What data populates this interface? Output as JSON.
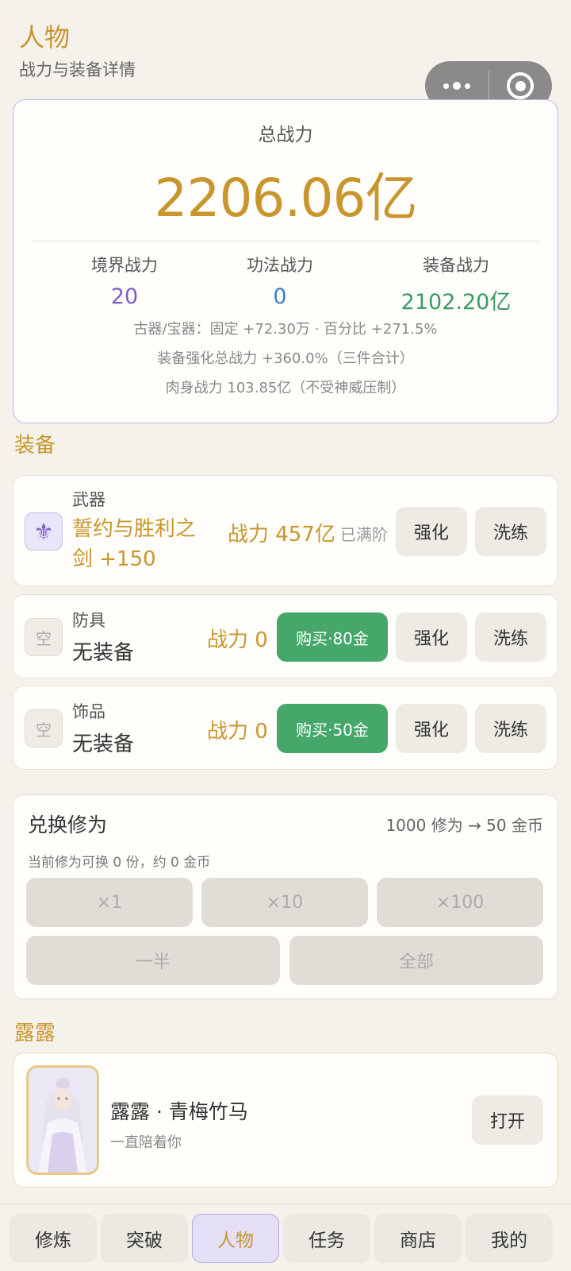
{
  "header": {
    "title": "人物",
    "subtitle": "战力与装备详情"
  },
  "capsule": {
    "more_icon": "more-dots-icon",
    "close_icon": "target-circle-icon"
  },
  "power": {
    "label": "总战力",
    "total": "2206.06亿",
    "stats": {
      "realm": {
        "label": "境界战力",
        "value": "20",
        "color": "#7b5ec6"
      },
      "skill": {
        "label": "功法战力",
        "value": "0",
        "color": "#3f7fc8"
      },
      "equip": {
        "label": "装备战力",
        "value": "2102.20亿",
        "color": "#3a9a64"
      }
    },
    "notes": [
      "古器/宝器：固定 +72.30万 · 百分比 +271.5%",
      "装备强化总战力 +360.0%（三件合计）",
      "肉身战力 103.85亿（不受神威压制）"
    ]
  },
  "equipment": {
    "section_title": "装备",
    "items": [
      {
        "icon": "fleur-de-lis-icon",
        "icon_glyph": "⚜",
        "type": "武器",
        "name_line1": "誓约与胜利之",
        "name_line2": "剑 +150",
        "power": "战力 457亿",
        "status": "已满阶",
        "enhance": "强化",
        "refine": "洗练"
      },
      {
        "icon_text": "空",
        "type": "防具",
        "name": "无装备",
        "power": "战力 0",
        "buy": "购买·80金",
        "enhance": "强化",
        "refine": "洗练"
      },
      {
        "icon_text": "空",
        "type": "饰品",
        "name": "无装备",
        "power": "战力 0",
        "buy": "购买·50金",
        "enhance": "强化",
        "refine": "洗练"
      }
    ]
  },
  "exchange": {
    "title": "兑换修为",
    "rate": "1000 修为 → 50 金币",
    "info": "当前修为可换 0 份，约 0 金币",
    "buttons": [
      "×1",
      "×10",
      "×100",
      "一半",
      "全部"
    ]
  },
  "companion": {
    "section_title": "露露",
    "name": "露露 · 青梅竹马",
    "desc": "一直陪着你",
    "open": "打开"
  },
  "tabs": [
    {
      "label": "修炼",
      "active": false
    },
    {
      "label": "突破",
      "active": false
    },
    {
      "label": "人物",
      "active": true
    },
    {
      "label": "任务",
      "active": false
    },
    {
      "label": "商店",
      "active": false
    },
    {
      "label": "我的",
      "active": false
    }
  ]
}
